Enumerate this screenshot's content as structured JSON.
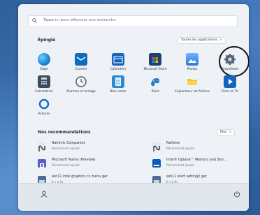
{
  "search": {
    "placeholder": "Tapez ici pour effectuer une recherche"
  },
  "pinned": {
    "title": "Épinglé",
    "all_apps_label": "Toutes les applications",
    "all_apps_chevron": ">",
    "apps": [
      {
        "label": "Edge",
        "icon": "edge-icon",
        "color": "#1e88d8"
      },
      {
        "label": "Courrier",
        "icon": "mail-icon",
        "color": "#0f6cbd"
      },
      {
        "label": "Calendrier",
        "icon": "calendar-icon",
        "color": "#1565c0"
      },
      {
        "label": "Microsoft Store",
        "icon": "store-icon",
        "color": "#1f3f7a"
      },
      {
        "label": "Photos",
        "icon": "photos-icon",
        "color": "#2b7bd3"
      },
      {
        "label": "Paramètres",
        "icon": "gear-icon",
        "color": "#5a6478"
      },
      {
        "label": "Calculatrice",
        "icon": "calculator-icon",
        "color": "#3b4a5e"
      },
      {
        "label": "Alarmes et horloge",
        "icon": "clock-icon",
        "color": "#4b5563"
      },
      {
        "label": "Bloc-notes",
        "icon": "notepad-icon",
        "color": "#2a8ad4"
      },
      {
        "label": "Paint",
        "icon": "paint-icon",
        "color": "#1b7fd6"
      },
      {
        "label": "Explorateur de fichiers",
        "icon": "folder-icon",
        "color": "#f2c230"
      },
      {
        "label": "Films et TV",
        "icon": "film-icon",
        "color": "#1565c0"
      },
      {
        "label": "Astuces",
        "icon": "tips-icon",
        "color": "#1e6fd1"
      }
    ]
  },
  "recommended": {
    "title": "Nos recommandations",
    "more_label": "Plus",
    "more_chevron": ">",
    "items": [
      {
        "name": "Nahimic Companion",
        "sub": "Récemment ajouté",
        "icon": "nahimic-icon",
        "color": "#e3e8ef"
      },
      {
        "name": "Nahimic",
        "sub": "Récemment ajouté",
        "icon": "nahimic-icon",
        "color": "#e3e8ef"
      },
      {
        "name": "Microsoft Teams (Preview)",
        "sub": "Récemment ajouté",
        "icon": "teams-icon",
        "color": "#5b5fc7"
      },
      {
        "name": "Intel® Optane™ Memory and Stor...",
        "sub": "Récemment ajouté",
        "icon": "intel-icon",
        "color": "#0a5bb5"
      },
      {
        "name": "win11 intel graphics cs menu ger",
        "sub": "Il y a 4s",
        "icon": "image-file-icon",
        "color": "#4f6b94"
      },
      {
        "name": "win11 start setting2 ger",
        "sub": "Il y a 6s",
        "icon": "image-file-icon",
        "color": "#4f6b94"
      }
    ]
  },
  "footer": {
    "user_icon": "user-icon",
    "power_icon": "power-icon"
  }
}
